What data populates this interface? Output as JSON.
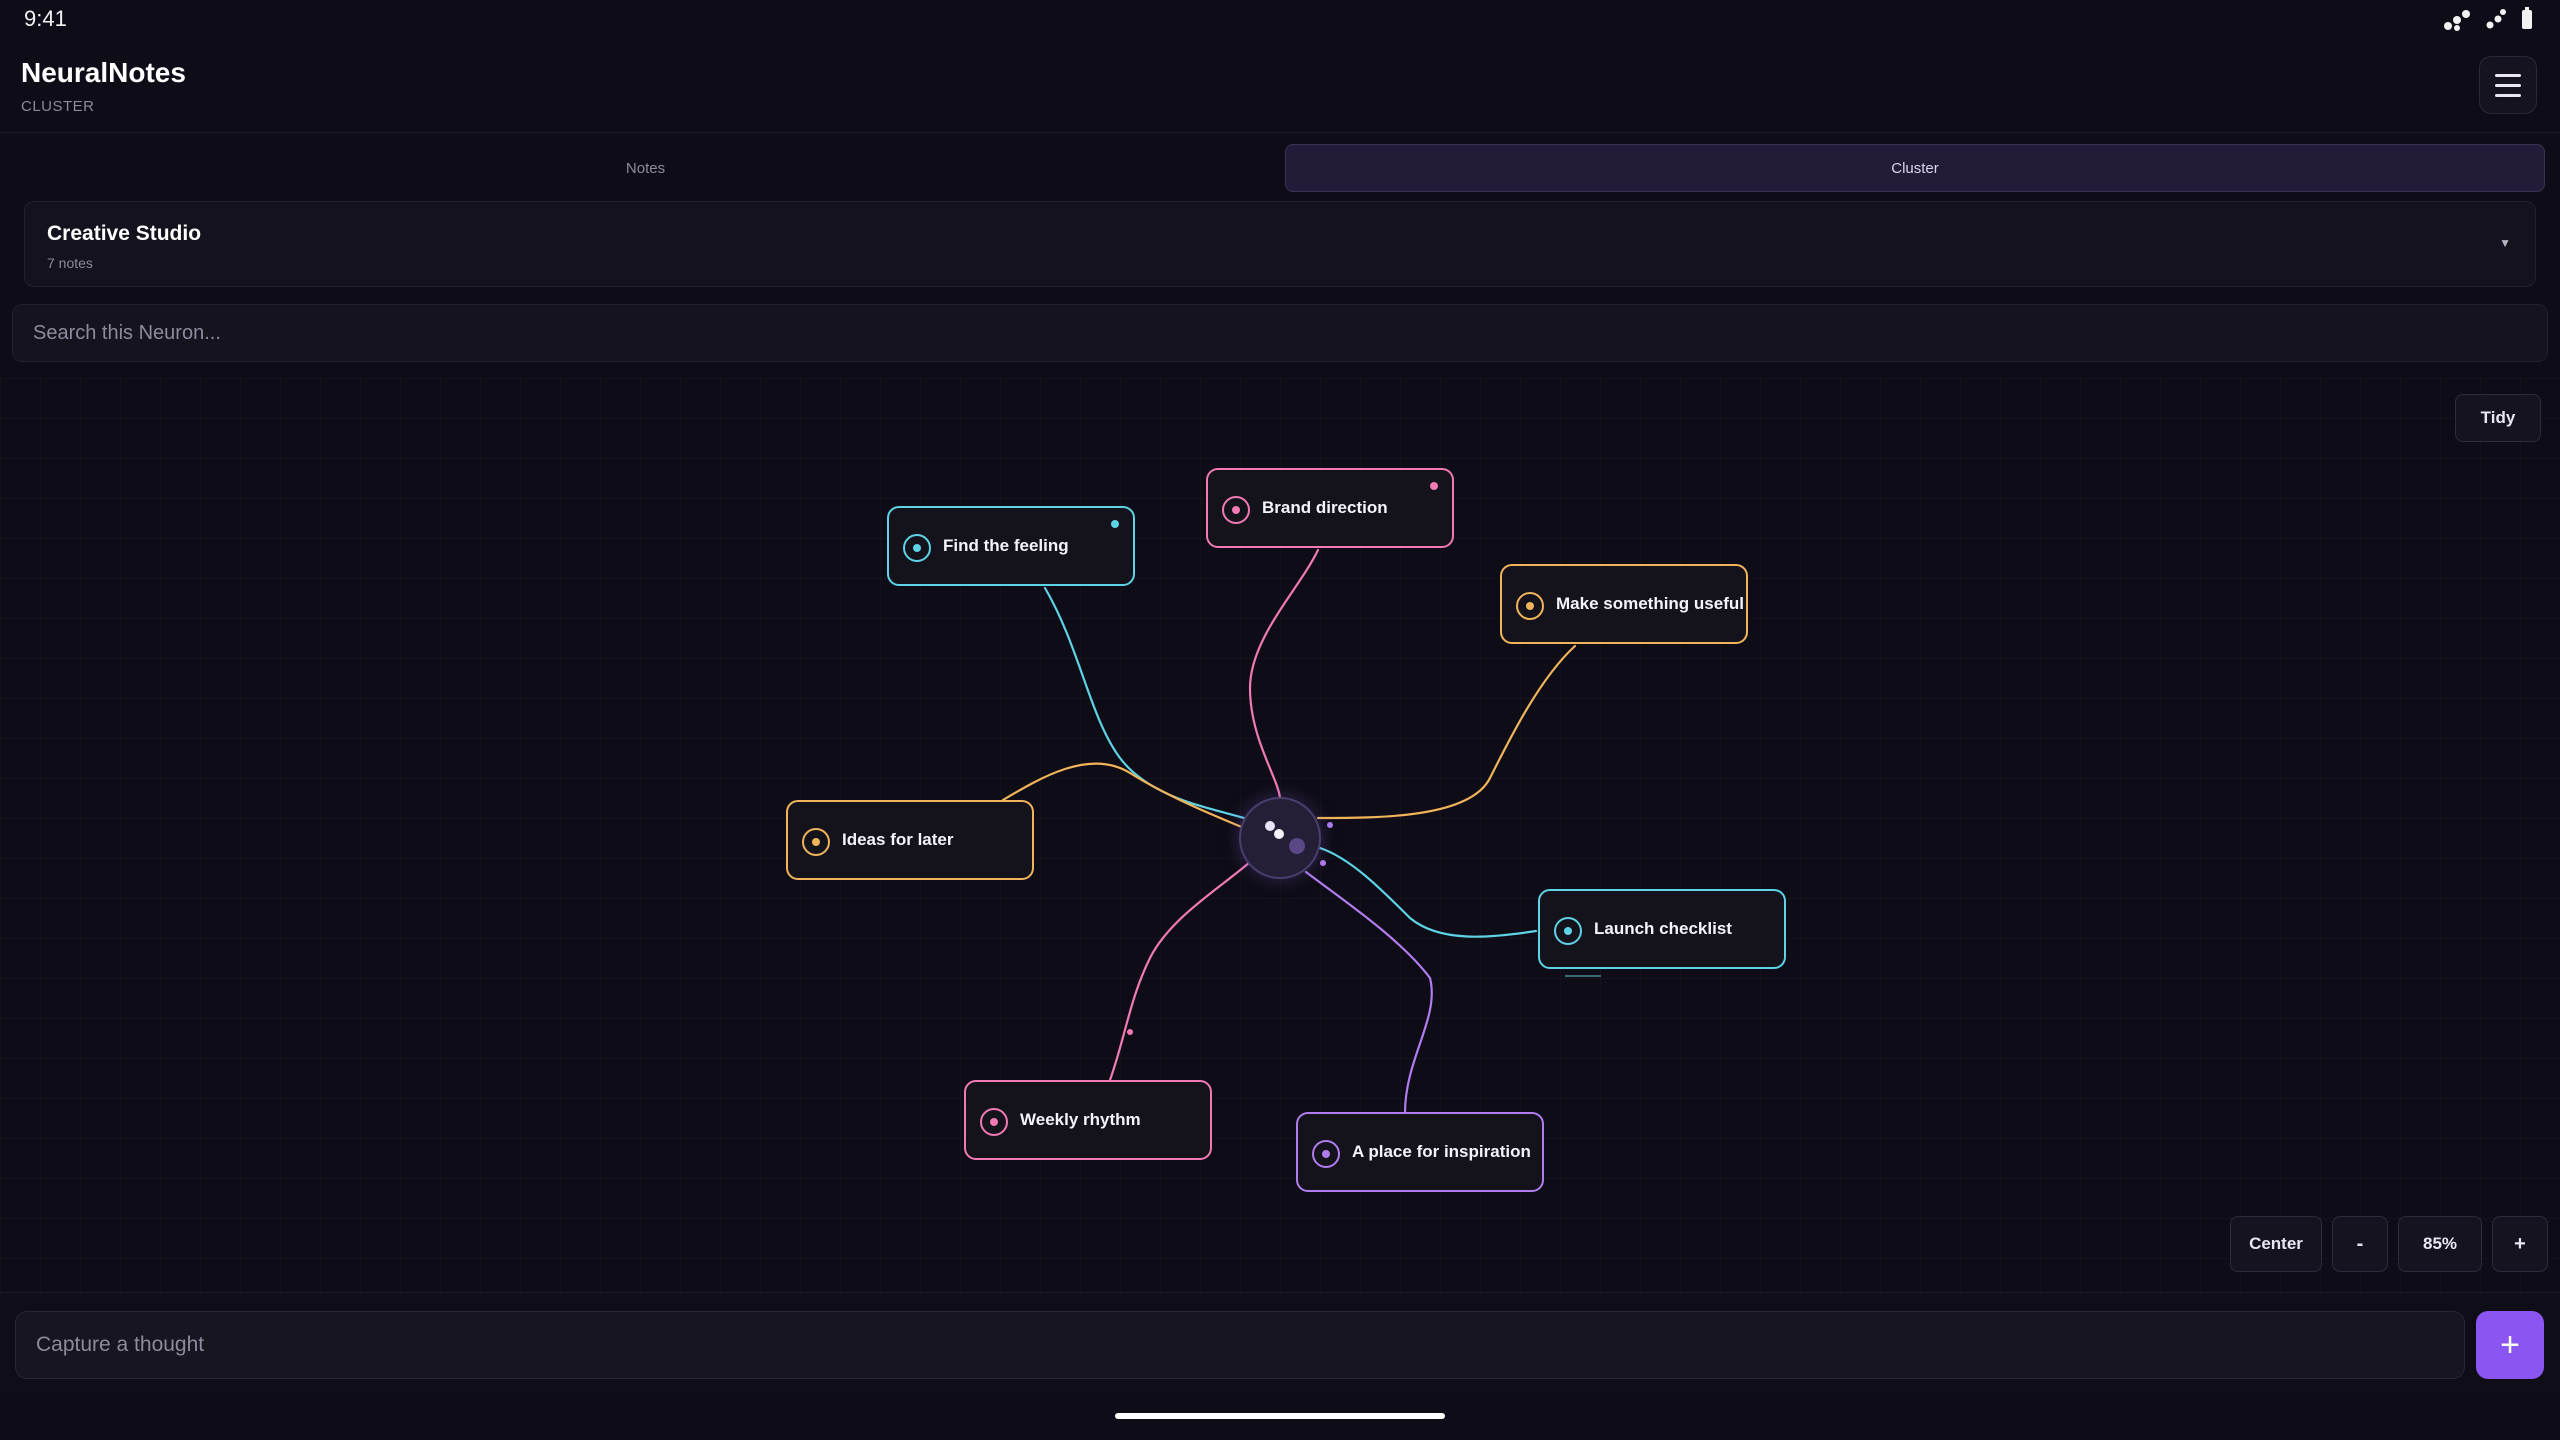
{
  "status_bar": {
    "time": "9:41"
  },
  "header": {
    "title": "NeuralNotes",
    "subtitle": "CLUSTER"
  },
  "tabs": [
    {
      "label": "Notes",
      "active": false
    },
    {
      "label": "Cluster",
      "active": true
    }
  ],
  "neuron": {
    "name": "Creative Studio",
    "count": "7 notes"
  },
  "search": {
    "placeholder": "Search this Neuron..."
  },
  "canvas": {
    "tidy_label": "Tidy",
    "nodes": [
      {
        "label": "Find the feeling",
        "color": "#5ed3e6"
      },
      {
        "label": "Brand direction",
        "color": "#f07ab3"
      },
      {
        "label": "Make something useful",
        "color": "#f0b45a"
      },
      {
        "label": "Ideas for later",
        "color": "#f0b45a"
      },
      {
        "label": "Launch checklist",
        "color": "#5ed3e6"
      },
      {
        "label": "Weekly rhythm",
        "color": "#f07ab3"
      },
      {
        "label": "A place for inspiration",
        "color": "#b07cf0"
      }
    ],
    "zoom": {
      "center_label": "Center",
      "minus_label": "-",
      "level": "85%",
      "plus_label": "+"
    }
  },
  "composer": {
    "placeholder": "Capture a thought",
    "add_label": "+"
  },
  "colors": {
    "accent": "#8a55f0",
    "cyan": "#5ed3e6",
    "pink": "#f07ab3",
    "amber": "#f0b45a",
    "violet": "#b07cf0"
  }
}
